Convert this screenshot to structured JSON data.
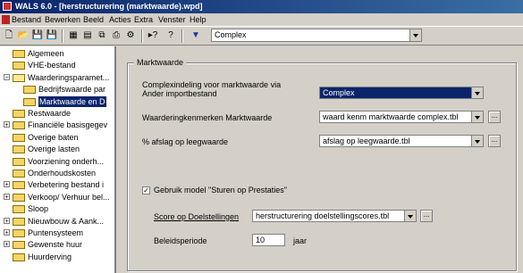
{
  "window": {
    "title": "WALS 6.0 - [herstructurering (marktwaarde).wpd]"
  },
  "menu": [
    "Bestand",
    "Bewerken",
    "Beeld",
    "Acties",
    "Extra",
    "Venster",
    "Help"
  ],
  "toolbar": {
    "complex_value": "Complex"
  },
  "tree": [
    {
      "label": "Algemeen",
      "expanded": null
    },
    {
      "label": "VHE-bestand",
      "expanded": null
    },
    {
      "label": "Waarderingsparamet...",
      "expanded": true
    },
    {
      "label": "Bedrijfswaarde par",
      "expanded": null
    },
    {
      "label": "Marktwaarde en D",
      "expanded": null,
      "selected": true
    },
    {
      "label": "Restwaarde",
      "expanded": null
    },
    {
      "label": "Financiële basisgegev",
      "expanded": false
    },
    {
      "label": "Overige baten",
      "expanded": null
    },
    {
      "label": "Overige lasten",
      "expanded": null
    },
    {
      "label": "Voorziening onderh...",
      "expanded": null
    },
    {
      "label": "Onderhoudskosten",
      "expanded": null
    },
    {
      "label": "Verbetering bestand i",
      "expanded": false
    },
    {
      "label": "Verkoop/ Verhuur bel...",
      "expanded": false
    },
    {
      "label": "Sloop",
      "expanded": null
    },
    {
      "label": "Nieuwbouw & Aank...",
      "expanded": false
    },
    {
      "label": "Puntensysteem",
      "expanded": false
    },
    {
      "label": "Gewenste huur",
      "expanded": false
    },
    {
      "label": "Huurderving",
      "expanded": null
    }
  ],
  "panel": {
    "legend": "Marktwaarde",
    "complex_label_line1": "Complexindeling voor marktwaarde via",
    "complex_label_line2": "Ander importbestand",
    "complex_value": "Complex",
    "kenmerken_label": "Waarderingkenmerken Marktwaarde",
    "kenmerken_value": "waard kenm marktwaarde complex.tbl",
    "afslag_label": "% afslag op leegwaarde",
    "afslag_value": "afslag op leegwaarde.tbl",
    "model_label": "Gebruik model \"Sturen op Prestaties\"",
    "model_checked": true,
    "scores_label": "Score op Doelstellingen",
    "scores_value": "herstructurering doelstellingscores.tbl",
    "periode_label": "Beleidsperiode",
    "periode_value": "10",
    "periode_unit": "jaar",
    "dots": "..."
  }
}
